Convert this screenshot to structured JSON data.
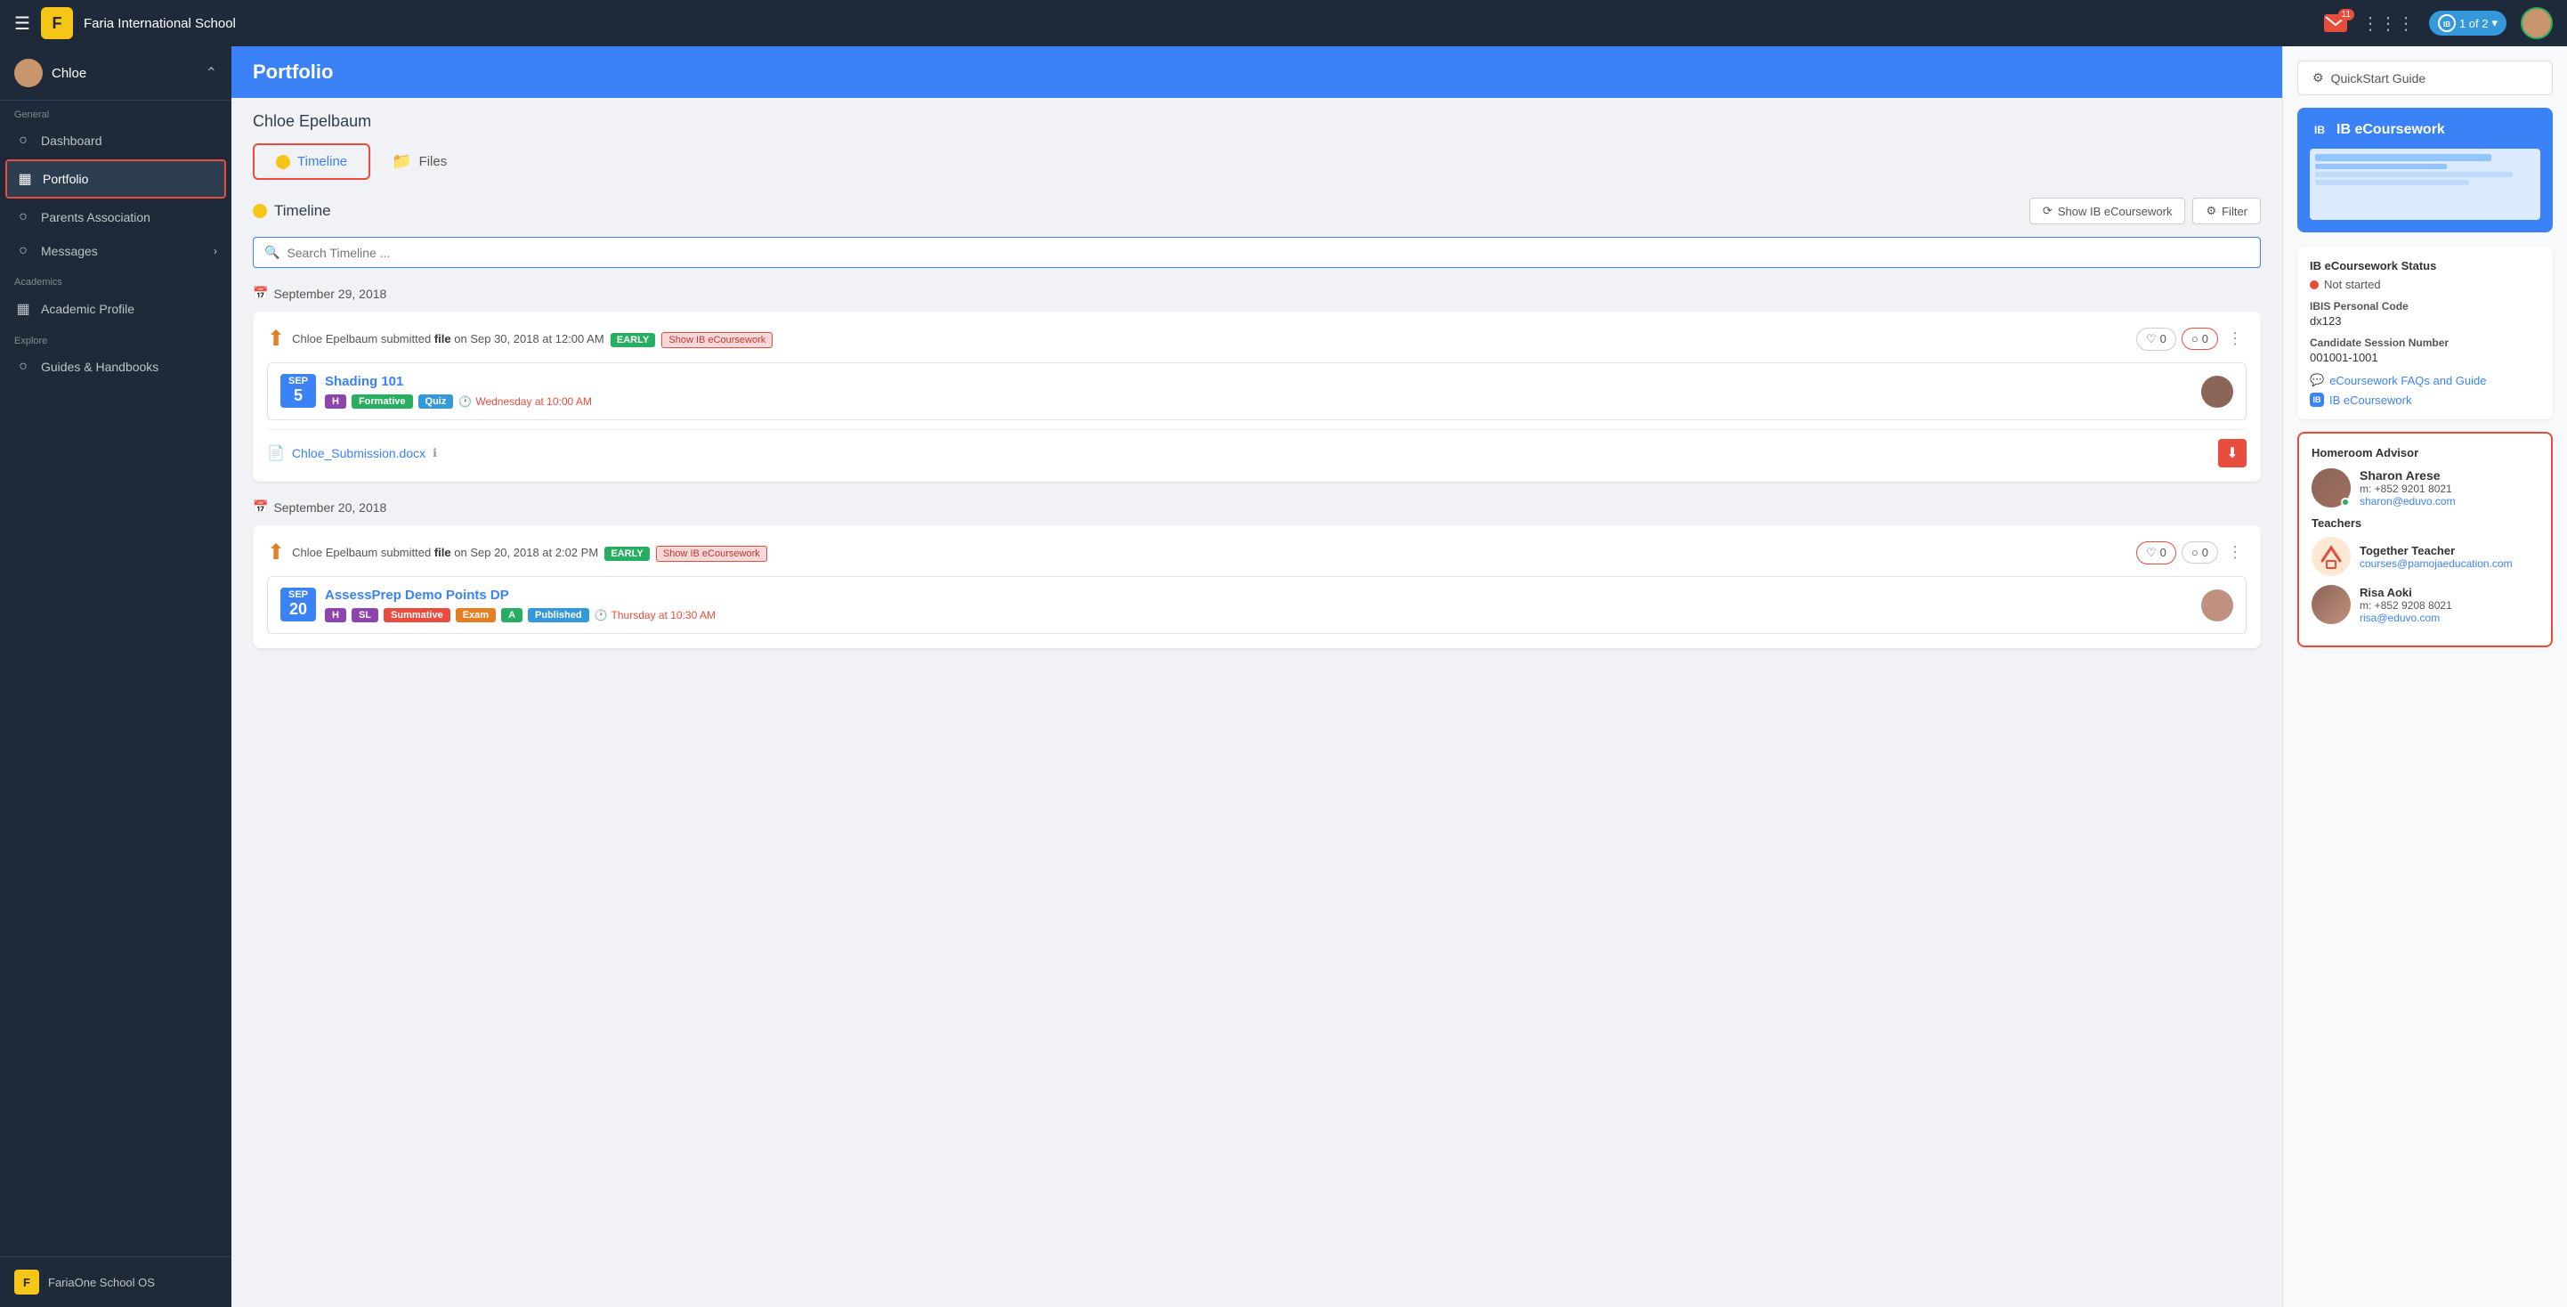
{
  "topbar": {
    "menu_icon": "☰",
    "logo_text": "F",
    "school_name": "Faria International School",
    "mail_count": "11",
    "grid_icon": "⋮⋮⋮",
    "session_text": "1 of 2",
    "quickstart_label": "QuickStart Guide"
  },
  "sidebar": {
    "user_name": "Chloe",
    "sections": [
      {
        "label": "General",
        "items": [
          {
            "id": "dashboard",
            "label": "Dashboard",
            "icon": "○"
          },
          {
            "id": "portfolio",
            "label": "Portfolio",
            "icon": "▦",
            "active": true
          },
          {
            "id": "parents",
            "label": "Parents Association",
            "icon": "○"
          },
          {
            "id": "messages",
            "label": "Messages",
            "icon": "○",
            "has_chevron": true
          }
        ]
      },
      {
        "label": "Academics",
        "items": [
          {
            "id": "academic-profile",
            "label": "Academic Profile",
            "icon": "▦"
          }
        ]
      },
      {
        "label": "Explore",
        "items": [
          {
            "id": "guides",
            "label": "Guides & Handbooks",
            "icon": "○"
          }
        ]
      }
    ],
    "footer_logo": "F",
    "footer_text": "FariaOne School OS"
  },
  "portfolio": {
    "title": "Portfolio",
    "student_name": "Chloe Epelbaum",
    "tabs": [
      {
        "id": "timeline",
        "label": "Timeline",
        "active": true
      },
      {
        "id": "files",
        "label": "Files"
      }
    ],
    "timeline_section": {
      "title": "Timeline",
      "show_ib_label": "Show IB eCoursework",
      "filter_label": "Filter",
      "search_placeholder": "Search Timeline ..."
    },
    "date_groups": [
      {
        "date": "September 29, 2018",
        "items": [
          {
            "id": "item1",
            "text_prefix": "Chloe Epelbaum submitted",
            "text_bold": "file",
            "text_suffix": "on Sep 30, 2018 at 12:00 AM",
            "badge_early": "EARLY",
            "badge_show": "Show IB eCoursework",
            "hearts": "0",
            "comments": "0",
            "course": {
              "month": "SEP",
              "day": "5",
              "title": "Shading 101",
              "badges": [
                "H",
                "Formative",
                "Quiz"
              ],
              "time": "Wednesday at 10:00 AM"
            },
            "file": {
              "name": "Chloe_Submission.docx"
            }
          }
        ]
      },
      {
        "date": "September 20, 2018",
        "items": [
          {
            "id": "item2",
            "text_prefix": "Chloe Epelbaum submitted",
            "text_bold": "file",
            "text_suffix": "on Sep 20, 2018 at 2:02 PM",
            "badge_early": "EARLY",
            "badge_show": "Show IB eCoursework",
            "hearts": "0",
            "comments": "0",
            "hearts_highlighted": true,
            "course": {
              "month": "SEP",
              "day": "20",
              "title": "AssessPrep Demo Points DP",
              "badges": [
                "H",
                "SL",
                "Summative",
                "Exam",
                "A",
                "Published"
              ],
              "time": "Thursday at 10:30 AM"
            }
          }
        ]
      }
    ]
  },
  "right_panel": {
    "quickstart_label": "QuickStart Guide",
    "ib_banner": {
      "title": "IB eCoursework"
    },
    "ib_status": {
      "section_label": "IB eCoursework Status",
      "status_value": "Not started",
      "ibis_label": "IBIS Personal Code",
      "ibis_value": "dx123",
      "candidate_label": "Candidate Session Number",
      "candidate_value": "001001-1001",
      "links": [
        {
          "label": "eCoursework FAQs and Guide"
        },
        {
          "label": "IB eCoursework"
        }
      ]
    },
    "homeroom": {
      "title": "Homeroom Advisor",
      "advisor": {
        "name": "Sharon Arese",
        "phone": "m: +852 9201 8021",
        "email": "sharon@eduvo.com",
        "online": true
      },
      "teachers_label": "Teachers",
      "teachers": [
        {
          "name": "Together Teacher",
          "email": "courses@pamojaeducation.com",
          "is_icon": true
        },
        {
          "name": "Risa Aoki",
          "phone": "m: +852 9208 8021",
          "email": "risa@eduvo.com"
        }
      ]
    }
  }
}
